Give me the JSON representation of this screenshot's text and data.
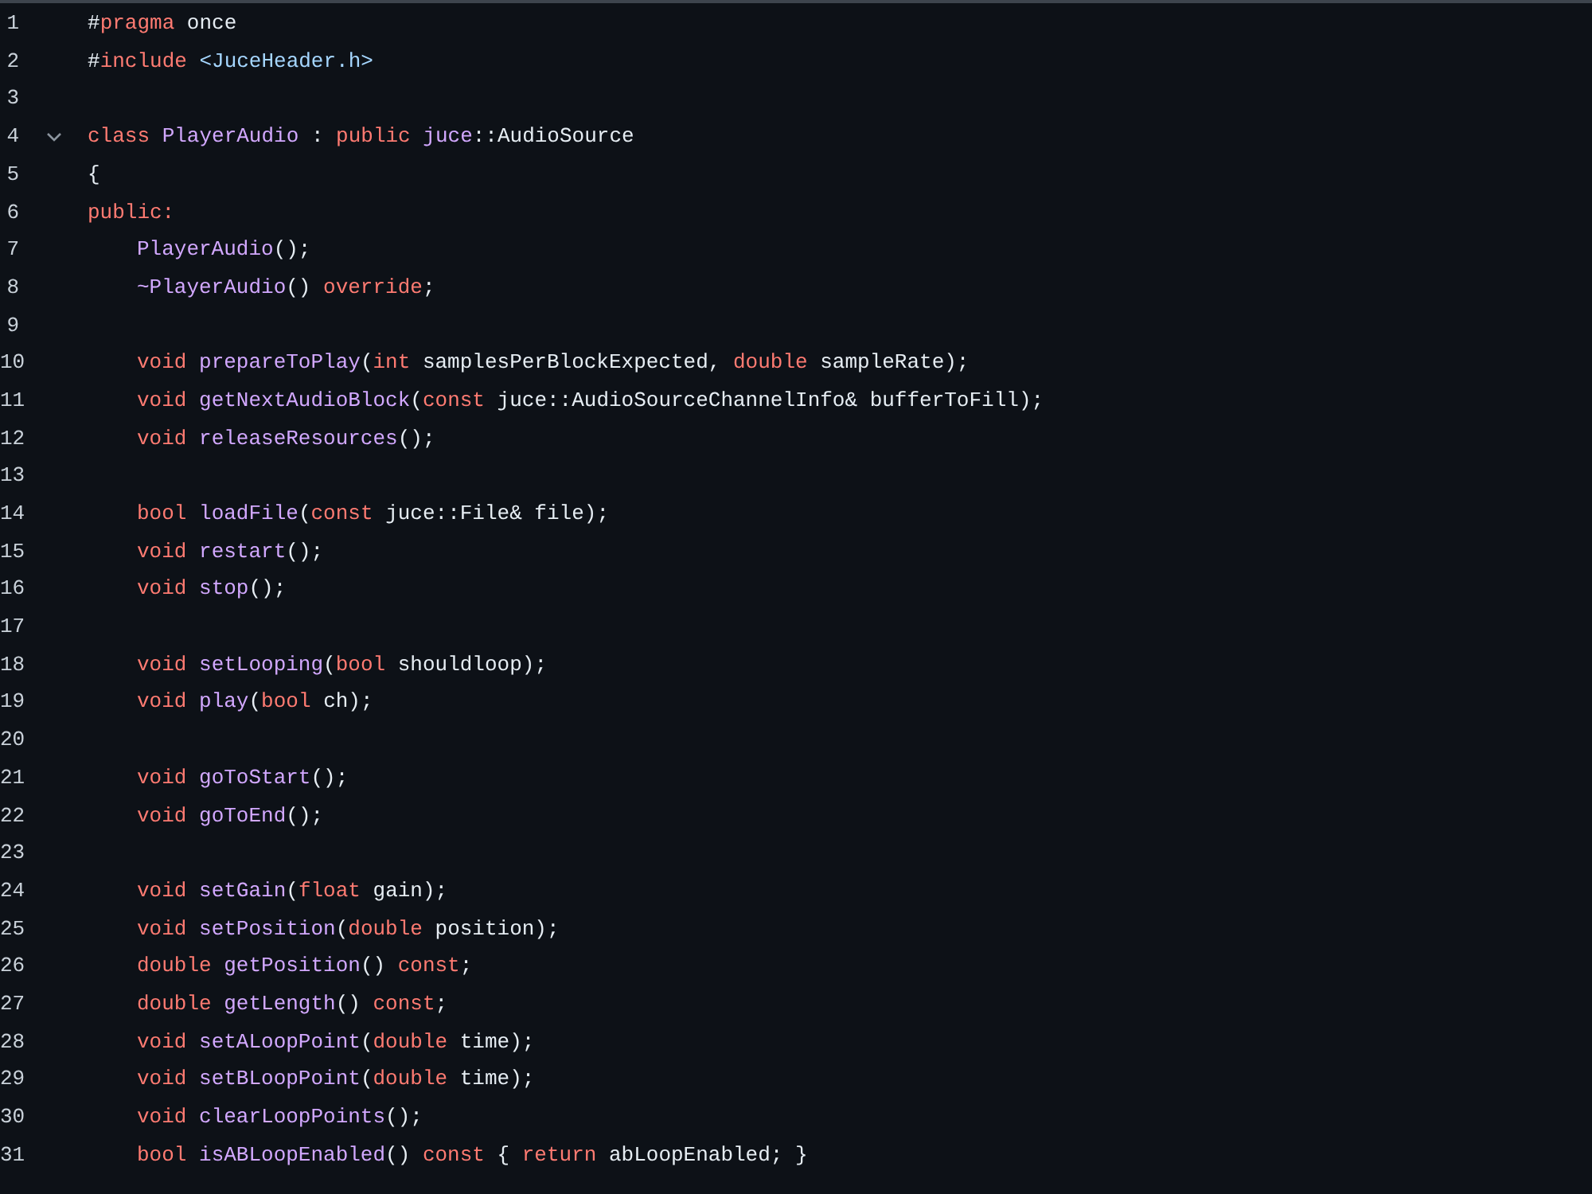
{
  "code_view": {
    "lines": [
      {
        "number": "1",
        "indented": false,
        "tokens": [
          {
            "text": "#",
            "kind": "plain"
          },
          {
            "text": "pragma",
            "kind": "keyword"
          },
          {
            "text": " once",
            "kind": "plain"
          }
        ]
      },
      {
        "number": "2",
        "indented": false,
        "tokens": [
          {
            "text": "#",
            "kind": "plain"
          },
          {
            "text": "include",
            "kind": "keyword"
          },
          {
            "text": " <JuceHeader.h>",
            "kind": "string"
          }
        ]
      },
      {
        "number": "3"
      },
      {
        "number": "4",
        "indented": false,
        "fold": {
          "expanded": true
        },
        "tokens": [
          {
            "text": "class",
            "kind": "keyword"
          },
          {
            "text": " PlayerAudio",
            "kind": "function"
          },
          {
            "text": " : ",
            "kind": "plain"
          },
          {
            "text": "public",
            "kind": "keyword"
          },
          {
            "text": " juce",
            "kind": "function"
          },
          {
            "text": "::AudioSource",
            "kind": "plain"
          }
        ]
      },
      {
        "number": "5",
        "indented": false,
        "tokens": [
          {
            "text": "{",
            "kind": "plain"
          }
        ]
      },
      {
        "number": "6",
        "indented": false,
        "tokens": [
          {
            "text": "public:",
            "kind": "keyword"
          }
        ]
      },
      {
        "number": "7",
        "indented": true,
        "tokens": [
          {
            "text": "PlayerAudio",
            "kind": "function"
          },
          {
            "text": "();",
            "kind": "plain"
          }
        ]
      },
      {
        "number": "8",
        "indented": true,
        "tokens": [
          {
            "text": "~PlayerAudio",
            "kind": "function"
          },
          {
            "text": "() ",
            "kind": "plain"
          },
          {
            "text": "override",
            "kind": "keyword"
          },
          {
            "text": ";",
            "kind": "plain"
          }
        ]
      },
      {
        "number": "9"
      },
      {
        "number": "10",
        "indented": true,
        "tokens": [
          {
            "text": "void",
            "kind": "keyword"
          },
          {
            "text": " prepareToPlay",
            "kind": "function"
          },
          {
            "text": "(",
            "kind": "plain"
          },
          {
            "text": "int",
            "kind": "keyword"
          },
          {
            "text": " samplesPerBlockExpected, ",
            "kind": "plain"
          },
          {
            "text": "double",
            "kind": "keyword"
          },
          {
            "text": " sampleRate);",
            "kind": "plain"
          }
        ]
      },
      {
        "number": "11",
        "indented": true,
        "tokens": [
          {
            "text": "void",
            "kind": "keyword"
          },
          {
            "text": " getNextAudioBlock",
            "kind": "function"
          },
          {
            "text": "(",
            "kind": "plain"
          },
          {
            "text": "const",
            "kind": "keyword"
          },
          {
            "text": " juce::AudioSourceChannelInfo& bufferToFill);",
            "kind": "plain"
          }
        ]
      },
      {
        "number": "12",
        "indented": true,
        "tokens": [
          {
            "text": "void",
            "kind": "keyword"
          },
          {
            "text": " releaseResources",
            "kind": "function"
          },
          {
            "text": "();",
            "kind": "plain"
          }
        ]
      },
      {
        "number": "13"
      },
      {
        "number": "14",
        "indented": true,
        "tokens": [
          {
            "text": "bool",
            "kind": "keyword"
          },
          {
            "text": " loadFile",
            "kind": "function"
          },
          {
            "text": "(",
            "kind": "plain"
          },
          {
            "text": "const",
            "kind": "keyword"
          },
          {
            "text": " juce::File& file);",
            "kind": "plain"
          }
        ]
      },
      {
        "number": "15",
        "indented": true,
        "tokens": [
          {
            "text": "void",
            "kind": "keyword"
          },
          {
            "text": " restart",
            "kind": "function"
          },
          {
            "text": "();",
            "kind": "plain"
          }
        ]
      },
      {
        "number": "16",
        "indented": true,
        "tokens": [
          {
            "text": "void",
            "kind": "keyword"
          },
          {
            "text": " stop",
            "kind": "function"
          },
          {
            "text": "();",
            "kind": "plain"
          }
        ]
      },
      {
        "number": "17"
      },
      {
        "number": "18",
        "indented": true,
        "tokens": [
          {
            "text": "void",
            "kind": "keyword"
          },
          {
            "text": " setLooping",
            "kind": "function"
          },
          {
            "text": "(",
            "kind": "plain"
          },
          {
            "text": "bool",
            "kind": "keyword"
          },
          {
            "text": " shouldloop);",
            "kind": "plain"
          }
        ]
      },
      {
        "number": "19",
        "indented": true,
        "tokens": [
          {
            "text": "void",
            "kind": "keyword"
          },
          {
            "text": " play",
            "kind": "function"
          },
          {
            "text": "(",
            "kind": "plain"
          },
          {
            "text": "bool",
            "kind": "keyword"
          },
          {
            "text": " ch);",
            "kind": "plain"
          }
        ]
      },
      {
        "number": "20"
      },
      {
        "number": "21",
        "indented": true,
        "tokens": [
          {
            "text": "void",
            "kind": "keyword"
          },
          {
            "text": " goToStart",
            "kind": "function"
          },
          {
            "text": "();",
            "kind": "plain"
          }
        ]
      },
      {
        "number": "22",
        "indented": true,
        "tokens": [
          {
            "text": "void",
            "kind": "keyword"
          },
          {
            "text": " goToEnd",
            "kind": "function"
          },
          {
            "text": "();",
            "kind": "plain"
          }
        ]
      },
      {
        "number": "23"
      },
      {
        "number": "24",
        "indented": true,
        "tokens": [
          {
            "text": "void",
            "kind": "keyword"
          },
          {
            "text": " setGain",
            "kind": "function"
          },
          {
            "text": "(",
            "kind": "plain"
          },
          {
            "text": "float",
            "kind": "keyword"
          },
          {
            "text": " gain);",
            "kind": "plain"
          }
        ]
      },
      {
        "number": "25",
        "indented": true,
        "tokens": [
          {
            "text": "void",
            "kind": "keyword"
          },
          {
            "text": " setPosition",
            "kind": "function"
          },
          {
            "text": "(",
            "kind": "plain"
          },
          {
            "text": "double",
            "kind": "keyword"
          },
          {
            "text": " position);",
            "kind": "plain"
          }
        ]
      },
      {
        "number": "26",
        "indented": true,
        "tokens": [
          {
            "text": "double",
            "kind": "keyword"
          },
          {
            "text": " getPosition",
            "kind": "function"
          },
          {
            "text": "() ",
            "kind": "plain"
          },
          {
            "text": "const",
            "kind": "keyword"
          },
          {
            "text": ";",
            "kind": "plain"
          }
        ]
      },
      {
        "number": "27",
        "indented": true,
        "tokens": [
          {
            "text": "double",
            "kind": "keyword"
          },
          {
            "text": " getLength",
            "kind": "function"
          },
          {
            "text": "() ",
            "kind": "plain"
          },
          {
            "text": "const",
            "kind": "keyword"
          },
          {
            "text": ";",
            "kind": "plain"
          }
        ]
      },
      {
        "number": "28",
        "indented": true,
        "tokens": [
          {
            "text": "void",
            "kind": "keyword"
          },
          {
            "text": " setALoopPoint",
            "kind": "function"
          },
          {
            "text": "(",
            "kind": "plain"
          },
          {
            "text": "double",
            "kind": "keyword"
          },
          {
            "text": " time);",
            "kind": "plain"
          }
        ]
      },
      {
        "number": "29",
        "indented": true,
        "tokens": [
          {
            "text": "void",
            "kind": "keyword"
          },
          {
            "text": " setBLoopPoint",
            "kind": "function"
          },
          {
            "text": "(",
            "kind": "plain"
          },
          {
            "text": "double",
            "kind": "keyword"
          },
          {
            "text": " time);",
            "kind": "plain"
          }
        ]
      },
      {
        "number": "30",
        "indented": true,
        "tokens": [
          {
            "text": "void",
            "kind": "keyword"
          },
          {
            "text": " clearLoopPoints",
            "kind": "function"
          },
          {
            "text": "();",
            "kind": "plain"
          }
        ]
      },
      {
        "number": "31",
        "indented": true,
        "tokens": [
          {
            "text": "bool",
            "kind": "keyword"
          },
          {
            "text": " isABLoopEnabled",
            "kind": "function"
          },
          {
            "text": "() ",
            "kind": "plain"
          },
          {
            "text": "const",
            "kind": "keyword"
          },
          {
            "text": " { ",
            "kind": "plain"
          },
          {
            "text": "return",
            "kind": "keyword"
          },
          {
            "text": " abLoopEnabled; }",
            "kind": "plain"
          }
        ]
      }
    ]
  }
}
